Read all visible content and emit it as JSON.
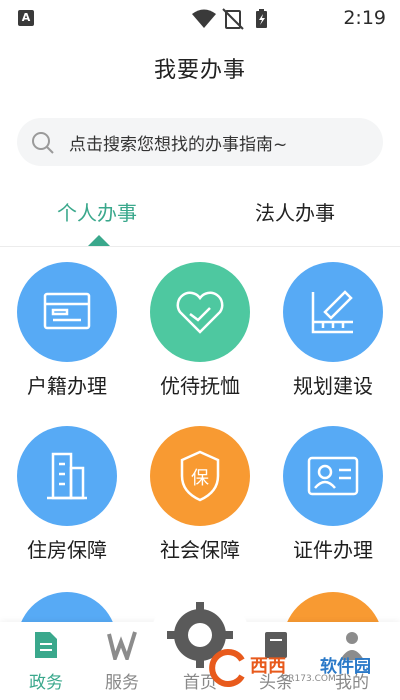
{
  "status": {
    "badge": "A",
    "time": "2:19"
  },
  "header": {
    "title": "我要办事"
  },
  "search": {
    "placeholder": "点击搜索您想找的办事指南~"
  },
  "tabs": [
    {
      "label": "个人办事",
      "active": true
    },
    {
      "label": "法人办事",
      "active": false
    }
  ],
  "services": [
    {
      "label": "户籍办理",
      "icon": "household-register-icon",
      "color": "#57aaf5"
    },
    {
      "label": "优待抚恤",
      "icon": "heart-hand-icon",
      "color": "#4ec8a0"
    },
    {
      "label": "规划建设",
      "icon": "ruler-pencil-icon",
      "color": "#57aaf5"
    },
    {
      "label": "住房保障",
      "icon": "building-icon",
      "color": "#57aaf5"
    },
    {
      "label": "社会保障",
      "icon": "insurance-badge-icon",
      "color": "#f89a32"
    },
    {
      "label": "证件办理",
      "icon": "id-card-icon",
      "color": "#57aaf5"
    }
  ],
  "nav": [
    {
      "label": "政务",
      "icon": "document-icon",
      "active": true
    },
    {
      "label": "服务",
      "icon": "service-w-icon",
      "active": false
    },
    {
      "label": "首页",
      "icon": "home-gear-icon",
      "active": false
    },
    {
      "label": "头条",
      "icon": "news-icon",
      "active": false
    },
    {
      "label": "我的",
      "icon": "person-icon",
      "active": false
    }
  ],
  "watermark": {
    "brand": "西西",
    "brand2": "软件园",
    "url": "CR173.COM"
  },
  "colors": {
    "accent": "#3aa88c",
    "blue": "#57aaf5",
    "green": "#4ec8a0",
    "orange": "#f89a32"
  }
}
